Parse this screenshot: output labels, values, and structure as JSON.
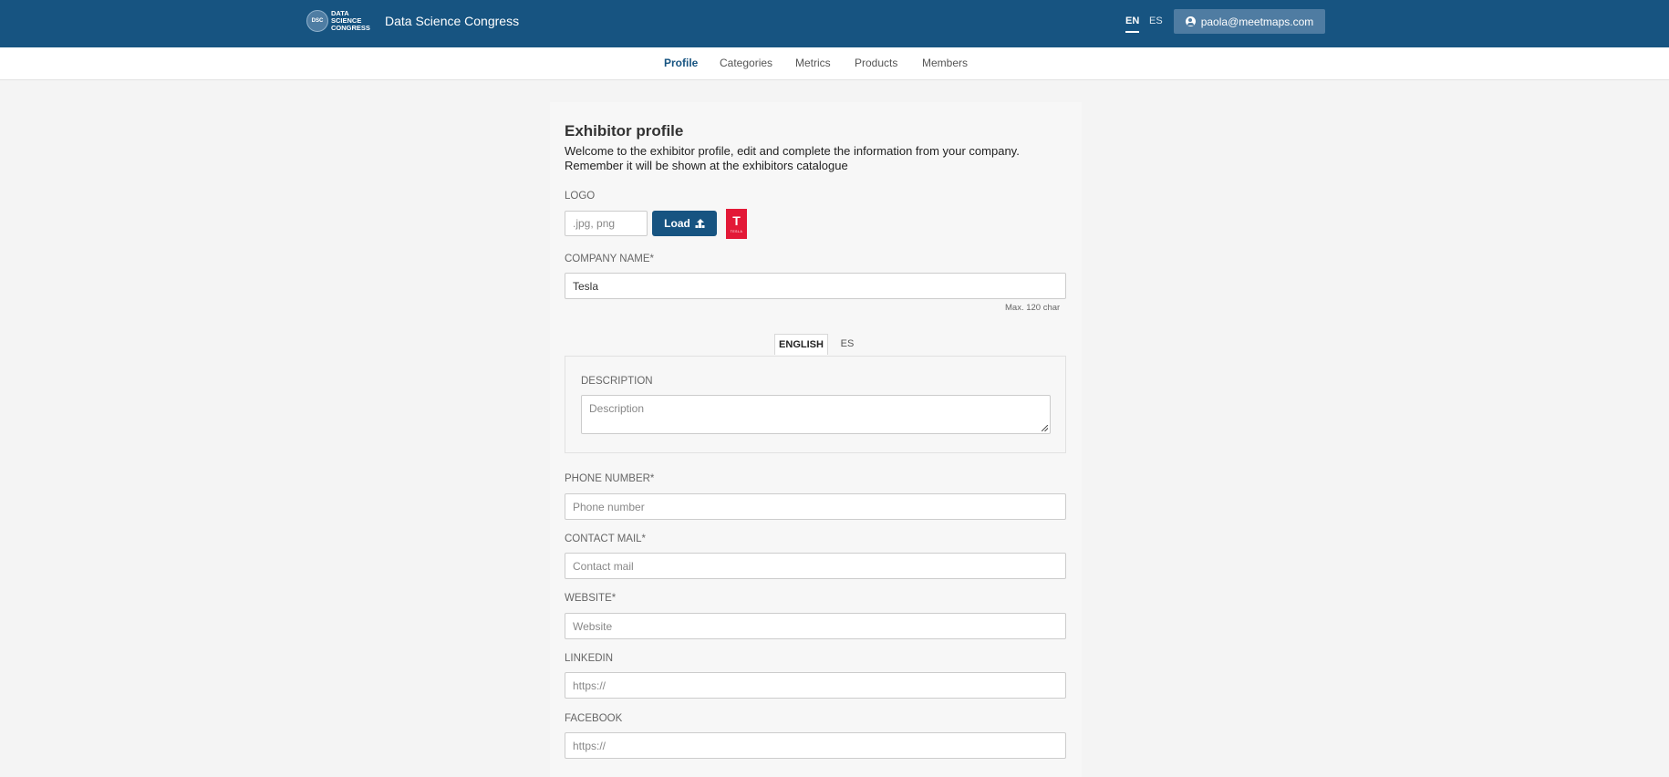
{
  "header": {
    "logo_initials": "DSC",
    "logo_lines": [
      "DATA",
      "SCIENCE",
      "CONGRESS"
    ],
    "title": "Data Science Congress",
    "languages": [
      {
        "code": "EN",
        "active": true
      },
      {
        "code": "ES",
        "active": false
      }
    ],
    "user_email": "paola@meetmaps.com"
  },
  "nav": {
    "tabs": [
      {
        "label": "Profile",
        "active": true
      },
      {
        "label": "Categories",
        "active": false
      },
      {
        "label": "Metrics",
        "active": false
      },
      {
        "label": "Products",
        "active": false
      },
      {
        "label": "Members",
        "active": false
      }
    ]
  },
  "form": {
    "heading": "Exhibitor profile",
    "intro_line1": "Welcome to the exhibitor profile, edit and complete the information from your company.",
    "intro_line2": "Remember it will be shown at the exhibitors catalogue",
    "logo": {
      "label": "LOGO",
      "placeholder": ".jpg, png",
      "load_button": "Load",
      "preview_letter": "T",
      "preview_word": "TESLA"
    },
    "company_name": {
      "label": "COMPANY NAME*",
      "value": "Tesla",
      "hint": "Max. 120 char"
    },
    "lang_tabs": [
      {
        "label": "ENGLISH",
        "active": true
      },
      {
        "label": "ES",
        "active": false
      }
    ],
    "description": {
      "label": "DESCRIPTION",
      "placeholder": "Description"
    },
    "phone": {
      "label": "PHONE NUMBER*",
      "placeholder": "Phone number"
    },
    "contact_mail": {
      "label": "CONTACT MAIL*",
      "placeholder": "Contact mail"
    },
    "website": {
      "label": "WEBSITE*",
      "placeholder": "Website"
    },
    "linkedin": {
      "label": "LINKEDIN",
      "placeholder": "https://"
    },
    "facebook": {
      "label": "FACEBOOK",
      "placeholder": "https://"
    }
  },
  "colors": {
    "brand": "#175481",
    "user_button": "#4f7ca2",
    "tesla_red": "#e31937",
    "page_bg": "#f4f4f4"
  }
}
